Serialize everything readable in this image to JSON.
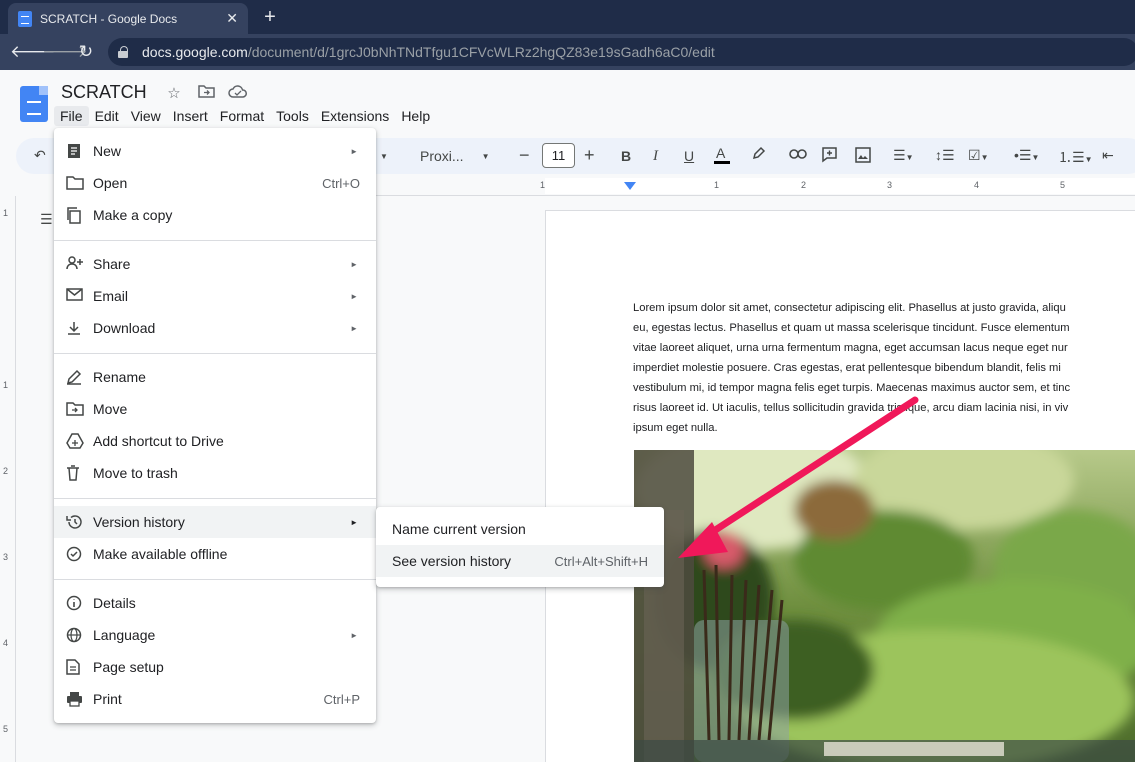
{
  "browser": {
    "tab_title": "SCRATCH - Google Docs",
    "tab_close": "✕",
    "new_tab": "+",
    "url_host": "docs.google.com",
    "url_path": "/document/d/1grcJ0bNhTNdTfgu1CFVcWLRz2hgQZ83e19sGadh6aC0/edit"
  },
  "docs": {
    "title": "SCRATCH",
    "menus": [
      "File",
      "Edit",
      "View",
      "Insert",
      "Format",
      "Tools",
      "Extensions",
      "Help"
    ],
    "toolbar": {
      "font_name": "Proxi...",
      "font_size": "11"
    },
    "ruler_numbers": [
      "1",
      "1",
      "2",
      "3",
      "4",
      "5"
    ],
    "vruler_numbers": [
      "1",
      "1",
      "2",
      "3",
      "4",
      "5"
    ],
    "body_lines": [
      "Lorem ipsum dolor sit amet, consectetur adipiscing elit. Phasellus at justo gravida, aliqu",
      "eu, egestas lectus. Phasellus et quam ut massa scelerisque tincidunt. Fusce elementum",
      "vitae laoreet aliquet, urna urna fermentum magna, eget accumsan lacus neque eget nur",
      "imperdiet molestie posuere. Cras egestas, erat pellentesque bibendum blandit, felis mi",
      "vestibulum mi, id tempor magna felis eget turpis. Maecenas maximus auctor sem, et tinc",
      "risus laoreet id. Ut iaculis, tellus sollicitudin gravida tristique, arcu diam lacinia nisi, in viv",
      "ipsum eget nulla."
    ]
  },
  "file_menu": {
    "items": [
      {
        "label": "New",
        "shortcut": "",
        "arrow": "►"
      },
      {
        "label": "Open",
        "shortcut": "Ctrl+O",
        "arrow": ""
      },
      {
        "label": "Make a copy",
        "shortcut": "",
        "arrow": ""
      },
      {
        "label": "Share",
        "shortcut": "",
        "arrow": "►"
      },
      {
        "label": "Email",
        "shortcut": "",
        "arrow": "►"
      },
      {
        "label": "Download",
        "shortcut": "",
        "arrow": "►"
      },
      {
        "label": "Rename",
        "shortcut": "",
        "arrow": ""
      },
      {
        "label": "Move",
        "shortcut": "",
        "arrow": ""
      },
      {
        "label": "Add shortcut to Drive",
        "shortcut": "",
        "arrow": ""
      },
      {
        "label": "Move to trash",
        "shortcut": "",
        "arrow": ""
      },
      {
        "label": "Version history",
        "shortcut": "",
        "arrow": "►"
      },
      {
        "label": "Make available offline",
        "shortcut": "",
        "arrow": ""
      },
      {
        "label": "Details",
        "shortcut": "",
        "arrow": ""
      },
      {
        "label": "Language",
        "shortcut": "",
        "arrow": "►"
      },
      {
        "label": "Page setup",
        "shortcut": "",
        "arrow": ""
      },
      {
        "label": "Print",
        "shortcut": "Ctrl+P",
        "arrow": ""
      }
    ]
  },
  "version_submenu": {
    "items": [
      {
        "label": "Name current version",
        "shortcut": ""
      },
      {
        "label": "See version history",
        "shortcut": "Ctrl+Alt+Shift+H"
      }
    ]
  },
  "colors": {
    "annotation_arrow": "#f0185a",
    "docs_blue": "#4285f4"
  }
}
